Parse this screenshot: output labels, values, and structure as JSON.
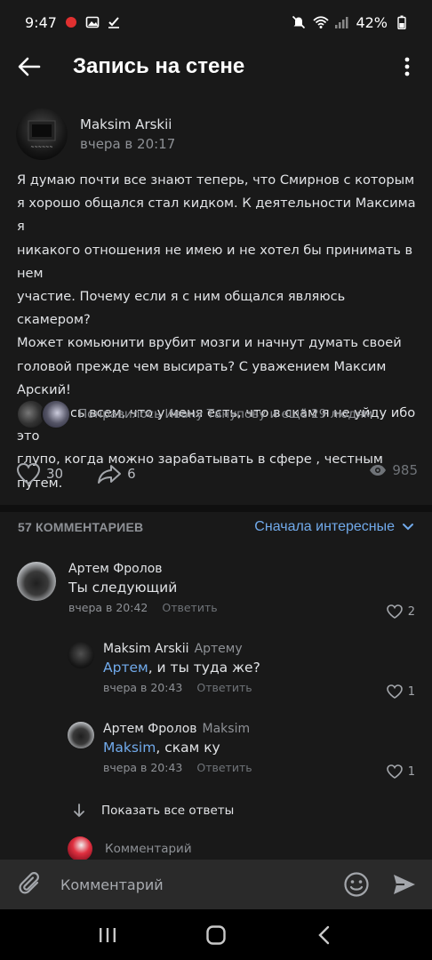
{
  "status": {
    "time": "9:47",
    "battery": "42%"
  },
  "header": {
    "title": "Запись на стене"
  },
  "post": {
    "author": "Maksim Arskii",
    "time": "вчера в 20:17",
    "text": "Я думаю почти все знают теперь, что Смирнов с которым\nя хорошо общался стал кидком. К деятельности Максима я\nникакого отношения не имею и не хотел бы принимать в нем\nучастие. Почему если я с ним общался являюсь скамером?\nМожет комьюнити врубит мозги и начнут думать своей\nголовой прежде чем высирать? С уважением Максим\nАрский!\nЯ клянусь всем, что у меня есть, что в скам я не уйду ибо это\nглупо, когда можно зарабатывать в сфере , честным путем.",
    "liked_by": "Понравилось Ивану Танупову и ещё 29 людям",
    "likes": "30",
    "shares": "6",
    "views": "985"
  },
  "comments_section": {
    "count_label": "57 КОММЕНТАРИЕВ",
    "sort_label": "Сначала интересные"
  },
  "comments": [
    {
      "author": "Артем Фролов",
      "text": "Ты следующий",
      "time": "вчера в 20:42",
      "reply_label": "Ответить",
      "likes": "2"
    },
    {
      "author": "Maksim Arskii",
      "to": "Артему",
      "mention": "Артем",
      "text": ", и ты туда же?",
      "time": "вчера в 20:43",
      "reply_label": "Ответить",
      "likes": "1"
    },
    {
      "author": "Артем Фролов",
      "to": "Maksim",
      "mention": "Maksim",
      "text": ", скам ку",
      "time": "вчера в 20:43",
      "reply_label": "Ответить",
      "likes": "1"
    }
  ],
  "show_replies_label": "Показать все ответы",
  "reply_preview_label": "Комментарий",
  "composer": {
    "placeholder": "Комментарий"
  },
  "colors": {
    "background": "#191919",
    "accent": "#71aaeb",
    "secondary_text": "#8e9196"
  }
}
